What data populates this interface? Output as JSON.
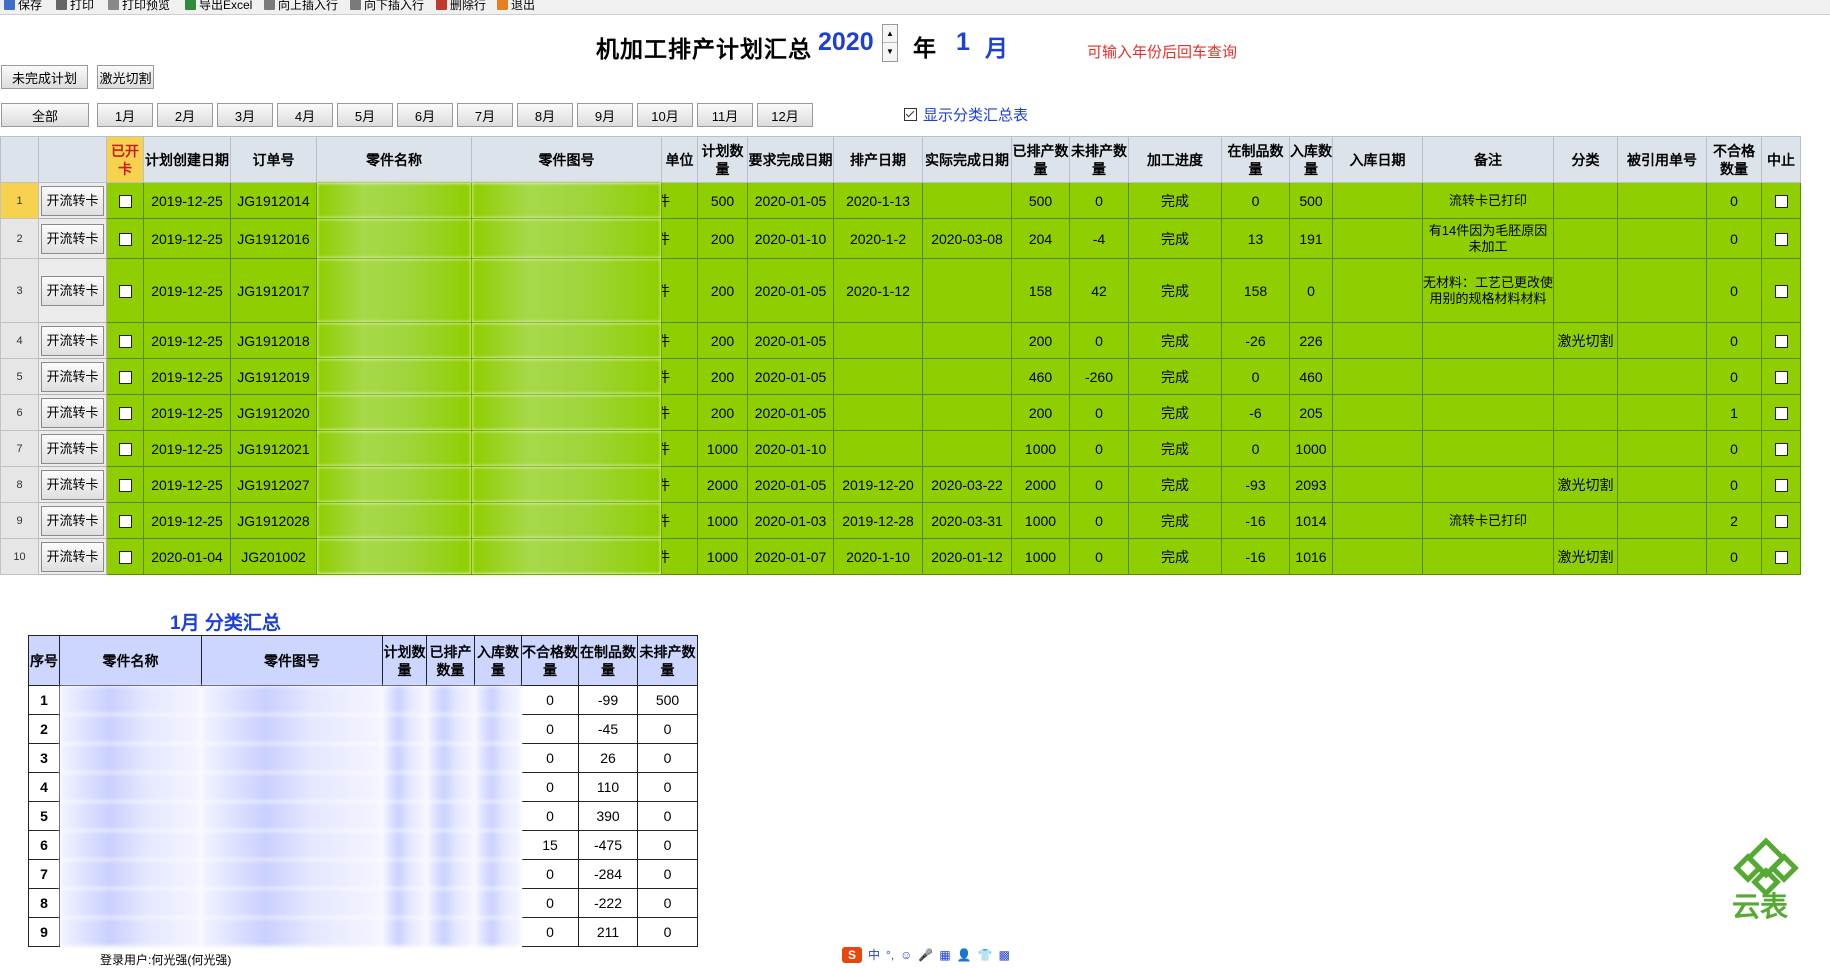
{
  "toolbar": [
    "保存",
    "打印",
    "打印预览",
    "导出Excel",
    "向上插入行",
    "向下插入行",
    "删除行",
    "退出"
  ],
  "title": {
    "main": "机加工排产计划汇总",
    "year": "2020",
    "year_unit": "年",
    "month": "1",
    "month_unit": "月",
    "hint": "可输入年份后回车查询"
  },
  "buttons": {
    "unfinished": "未完成计划",
    "laser": "激光切割"
  },
  "months": [
    "全部",
    "1月",
    "2月",
    "3月",
    "4月",
    "5月",
    "6月",
    "7月",
    "8月",
    "9月",
    "10月",
    "11月",
    "12月"
  ],
  "show_summary_label": "显示分类汇总表",
  "colors": {
    "accent_blue": "#1d3fd6",
    "hint_red": "#e0302a",
    "row_green": "#8fce00",
    "summary_header": "#ccd6ff"
  },
  "grid": {
    "headers": [
      "",
      "",
      "已开卡",
      "计划创建日期",
      "订单号",
      "零件名称",
      "零件图号",
      "单位",
      "计划数量",
      "要求完成日期",
      "排产日期",
      "实际完成日期",
      "已排产数量",
      "未排产数量",
      "加工进度",
      "在制品数量",
      "入库数量",
      "入库日期",
      "备注",
      "分类",
      "被引用单号",
      "不合格数量",
      "中止"
    ],
    "rows": [
      {
        "n": "1",
        "btn": "开流转卡",
        "created": "2019-12-25",
        "order": "JG1912014",
        "unit": "件",
        "qty": "500",
        "due": "2020-01-05",
        "sched": "2020-1-13",
        "actual": "",
        "done": "500",
        "todo": "0",
        "progress": "完成",
        "wip": "0",
        "stock": "500",
        "stock_date": "",
        "note": "流转卡已打印",
        "cat": "",
        "ref": "",
        "bad": "0"
      },
      {
        "n": "2",
        "btn": "开流转卡",
        "created": "2019-12-25",
        "order": "JG1912016",
        "unit": "件",
        "qty": "200",
        "due": "2020-01-10",
        "sched": "2020-1-2",
        "actual": "2020-03-08",
        "done": "204",
        "todo": "-4",
        "progress": "完成",
        "wip": "13",
        "stock": "191",
        "stock_date": "",
        "note": "有14件因为毛胚原因未加工",
        "cat": "",
        "ref": "",
        "bad": "0"
      },
      {
        "n": "3",
        "btn": "开流转卡",
        "created": "2019-12-25",
        "order": "JG1912017",
        "unit": "件",
        "qty": "200",
        "due": "2020-01-05",
        "sched": "2020-1-12",
        "actual": "",
        "done": "158",
        "todo": "42",
        "progress": "完成",
        "wip": "158",
        "stock": "0",
        "stock_date": "",
        "note": "无材料：工艺已更改使用别的规格材料材料",
        "cat": "",
        "ref": "",
        "bad": "0"
      },
      {
        "n": "4",
        "btn": "开流转卡",
        "created": "2019-12-25",
        "order": "JG1912018",
        "unit": "件",
        "qty": "200",
        "due": "2020-01-05",
        "sched": "",
        "actual": "",
        "done": "200",
        "todo": "0",
        "progress": "完成",
        "wip": "-26",
        "stock": "226",
        "stock_date": "",
        "note": "",
        "cat": "激光切割",
        "ref": "",
        "bad": "0"
      },
      {
        "n": "5",
        "btn": "开流转卡",
        "created": "2019-12-25",
        "order": "JG1912019",
        "unit": "件",
        "qty": "200",
        "due": "2020-01-05",
        "sched": "",
        "actual": "",
        "done": "460",
        "todo": "-260",
        "progress": "完成",
        "wip": "0",
        "stock": "460",
        "stock_date": "",
        "note": "",
        "cat": "",
        "ref": "",
        "bad": "0"
      },
      {
        "n": "6",
        "btn": "开流转卡",
        "created": "2019-12-25",
        "order": "JG1912020",
        "unit": "件",
        "qty": "200",
        "due": "2020-01-05",
        "sched": "",
        "actual": "",
        "done": "200",
        "todo": "0",
        "progress": "完成",
        "wip": "-6",
        "stock": "205",
        "stock_date": "",
        "note": "",
        "cat": "",
        "ref": "",
        "bad": "1"
      },
      {
        "n": "7",
        "btn": "开流转卡",
        "created": "2019-12-25",
        "order": "JG1912021",
        "unit": "件",
        "qty": "1000",
        "due": "2020-01-10",
        "sched": "",
        "actual": "",
        "done": "1000",
        "todo": "0",
        "progress": "完成",
        "wip": "0",
        "stock": "1000",
        "stock_date": "",
        "note": "",
        "cat": "",
        "ref": "",
        "bad": "0"
      },
      {
        "n": "8",
        "btn": "开流转卡",
        "created": "2019-12-25",
        "order": "JG1912027",
        "unit": "件",
        "qty": "2000",
        "due": "2020-01-05",
        "sched": "2019-12-20",
        "actual": "2020-03-22",
        "done": "2000",
        "todo": "0",
        "progress": "完成",
        "wip": "-93",
        "stock": "2093",
        "stock_date": "",
        "note": "",
        "cat": "激光切割",
        "ref": "",
        "bad": "0"
      },
      {
        "n": "9",
        "btn": "开流转卡",
        "created": "2019-12-25",
        "order": "JG1912028",
        "unit": "件",
        "qty": "1000",
        "due": "2020-01-03",
        "sched": "2019-12-28",
        "actual": "2020-03-31",
        "done": "1000",
        "todo": "0",
        "progress": "完成",
        "wip": "-16",
        "stock": "1014",
        "stock_date": "",
        "note": "流转卡已打印",
        "cat": "",
        "ref": "",
        "bad": "2"
      },
      {
        "n": "10",
        "btn": "开流转卡",
        "created": "2020-01-04",
        "order": "JG201002",
        "unit": "件",
        "qty": "1000",
        "due": "2020-01-07",
        "sched": "2020-1-10",
        "actual": "2020-01-12",
        "done": "1000",
        "todo": "0",
        "progress": "完成",
        "wip": "-16",
        "stock": "1016",
        "stock_date": "",
        "note": "",
        "cat": "激光切割",
        "ref": "",
        "bad": "0"
      }
    ]
  },
  "summary": {
    "title": "1月 分类汇总",
    "headers": [
      "序号",
      "零件名称",
      "零件图号",
      "计划数量",
      "已排产数量",
      "入库数量",
      "不合格数量",
      "在制品数量",
      "未排产数量"
    ],
    "rows": [
      {
        "idx": "1",
        "bad": "0",
        "wip": "-99",
        "todo": "500"
      },
      {
        "idx": "2",
        "bad": "0",
        "wip": "-45",
        "todo": "0"
      },
      {
        "idx": "3",
        "bad": "0",
        "wip": "26",
        "todo": "0"
      },
      {
        "idx": "4",
        "bad": "0",
        "wip": "110",
        "todo": "0"
      },
      {
        "idx": "5",
        "bad": "0",
        "wip": "390",
        "todo": "0"
      },
      {
        "idx": "6",
        "bad": "15",
        "wip": "-475",
        "todo": "0"
      },
      {
        "idx": "7",
        "bad": "0",
        "wip": "-284",
        "todo": "0"
      },
      {
        "idx": "8",
        "bad": "0",
        "wip": "-222",
        "todo": "0"
      },
      {
        "idx": "9",
        "bad": "0",
        "wip": "211",
        "todo": "0"
      }
    ]
  },
  "status": {
    "user": "登录用户:何光强(何光强)"
  },
  "ime": [
    "中",
    "°,",
    "☺",
    "🎤",
    "▦",
    "👤",
    "👕",
    "▩"
  ],
  "watermark": "云表"
}
